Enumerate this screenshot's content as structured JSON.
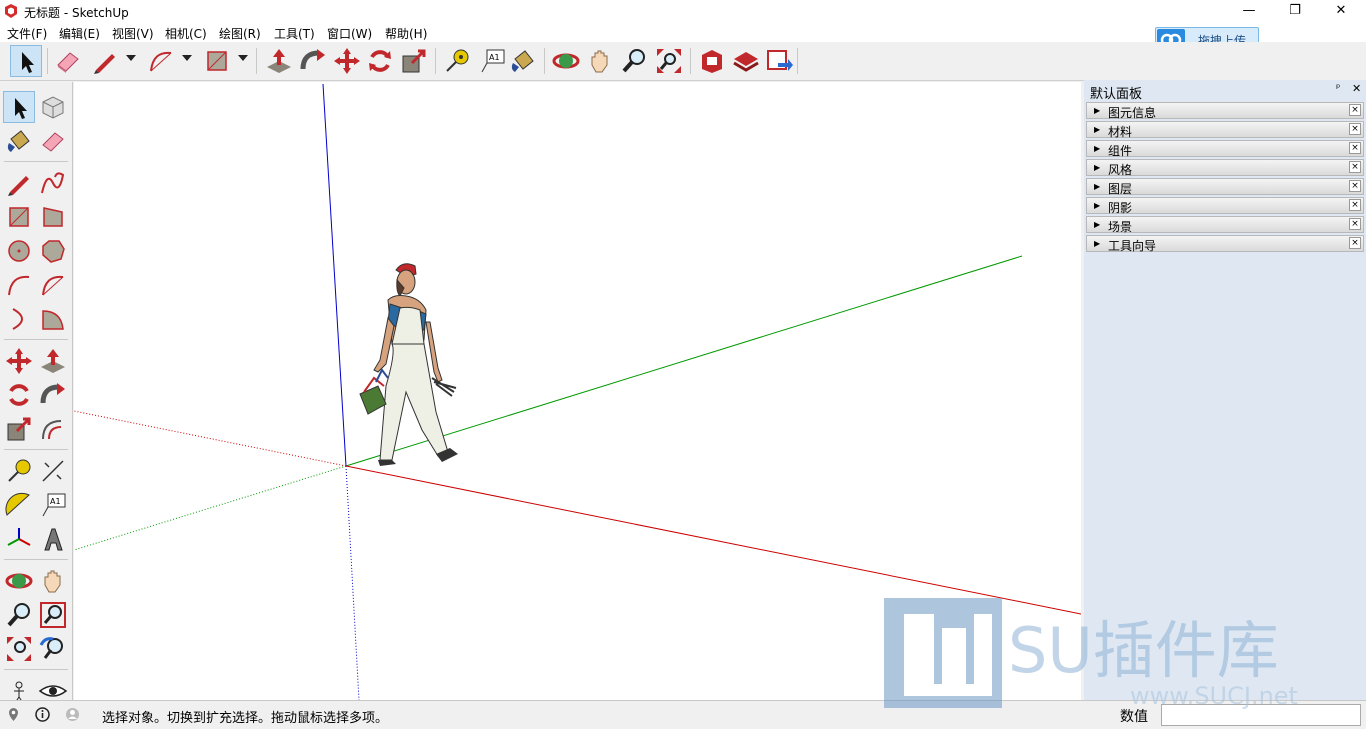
{
  "window": {
    "title": "无标题 - SketchUp",
    "controls": {
      "minimize": "—",
      "restore": "❐",
      "close": "✕"
    }
  },
  "menubar": {
    "items": [
      "文件(F)",
      "编辑(E)",
      "视图(V)",
      "相机(C)",
      "绘图(R)",
      "工具(T)",
      "窗口(W)",
      "帮助(H)"
    ]
  },
  "upload_button": {
    "label": "拖拽上传",
    "icon": "cloud-upload-icon"
  },
  "toolbar": {
    "tools": [
      "select-icon",
      "eraser-icon",
      "pencil-icon",
      "arc-icon",
      "rectangle-icon",
      "push-pull-icon",
      "follow-me-icon",
      "move-icon",
      "rotate-icon",
      "scale-icon",
      "tape-measure-icon",
      "text-icon",
      "paint-bucket-icon",
      "orbit-icon",
      "pan-icon",
      "zoom-icon",
      "zoom-extents-icon",
      "warehouse-icon",
      "extension-warehouse-icon",
      "share-model-icon"
    ]
  },
  "left_toolbar": {
    "tools": [
      "select-icon",
      "component-icon",
      "paint-bucket-icon",
      "eraser-icon",
      "line-icon",
      "freehand-icon",
      "rectangle-icon",
      "rotated-rectangle-icon",
      "circle-icon",
      "polygon-icon",
      "arc-icon",
      "two-point-arc-icon",
      "three-point-arc-icon",
      "pie-icon",
      "move-icon",
      "push-pull-icon",
      "rotate-icon",
      "follow-me-icon",
      "scale-icon",
      "offset-icon",
      "tape-measure-icon",
      "dimension-icon",
      "protractor-icon",
      "text-icon",
      "axes-icon",
      "3d-text-icon",
      "orbit-icon",
      "pan-icon",
      "zoom-icon",
      "zoom-window-icon",
      "zoom-extents-icon",
      "previous-view-icon",
      "position-camera-icon",
      "look-around-icon"
    ]
  },
  "panel": {
    "title": "默认面板",
    "pin": "ᵖ",
    "close": "✕",
    "trays": [
      "图元信息",
      "材料",
      "组件",
      "风格",
      "图层",
      "阴影",
      "场景",
      "工具向导"
    ],
    "tray_close": "×",
    "tray_arrow": "▶"
  },
  "statusbar": {
    "message": "选择对象。切换到扩充选择。拖动鼠标选择多项。",
    "vcb_label": "数值",
    "vcb_value": "",
    "icons": [
      "geo-location-icon",
      "info-icon",
      "user-icon"
    ]
  },
  "watermark": {
    "text": "SU插件库",
    "subtext": "www.SUCJ.net"
  },
  "colors": {
    "red_axis": "#cc0000",
    "green_axis": "#009900",
    "blue_axis": "#0000cc",
    "panel_bg": "#dfe8f2",
    "upload_accent": "#2a8ae0"
  }
}
